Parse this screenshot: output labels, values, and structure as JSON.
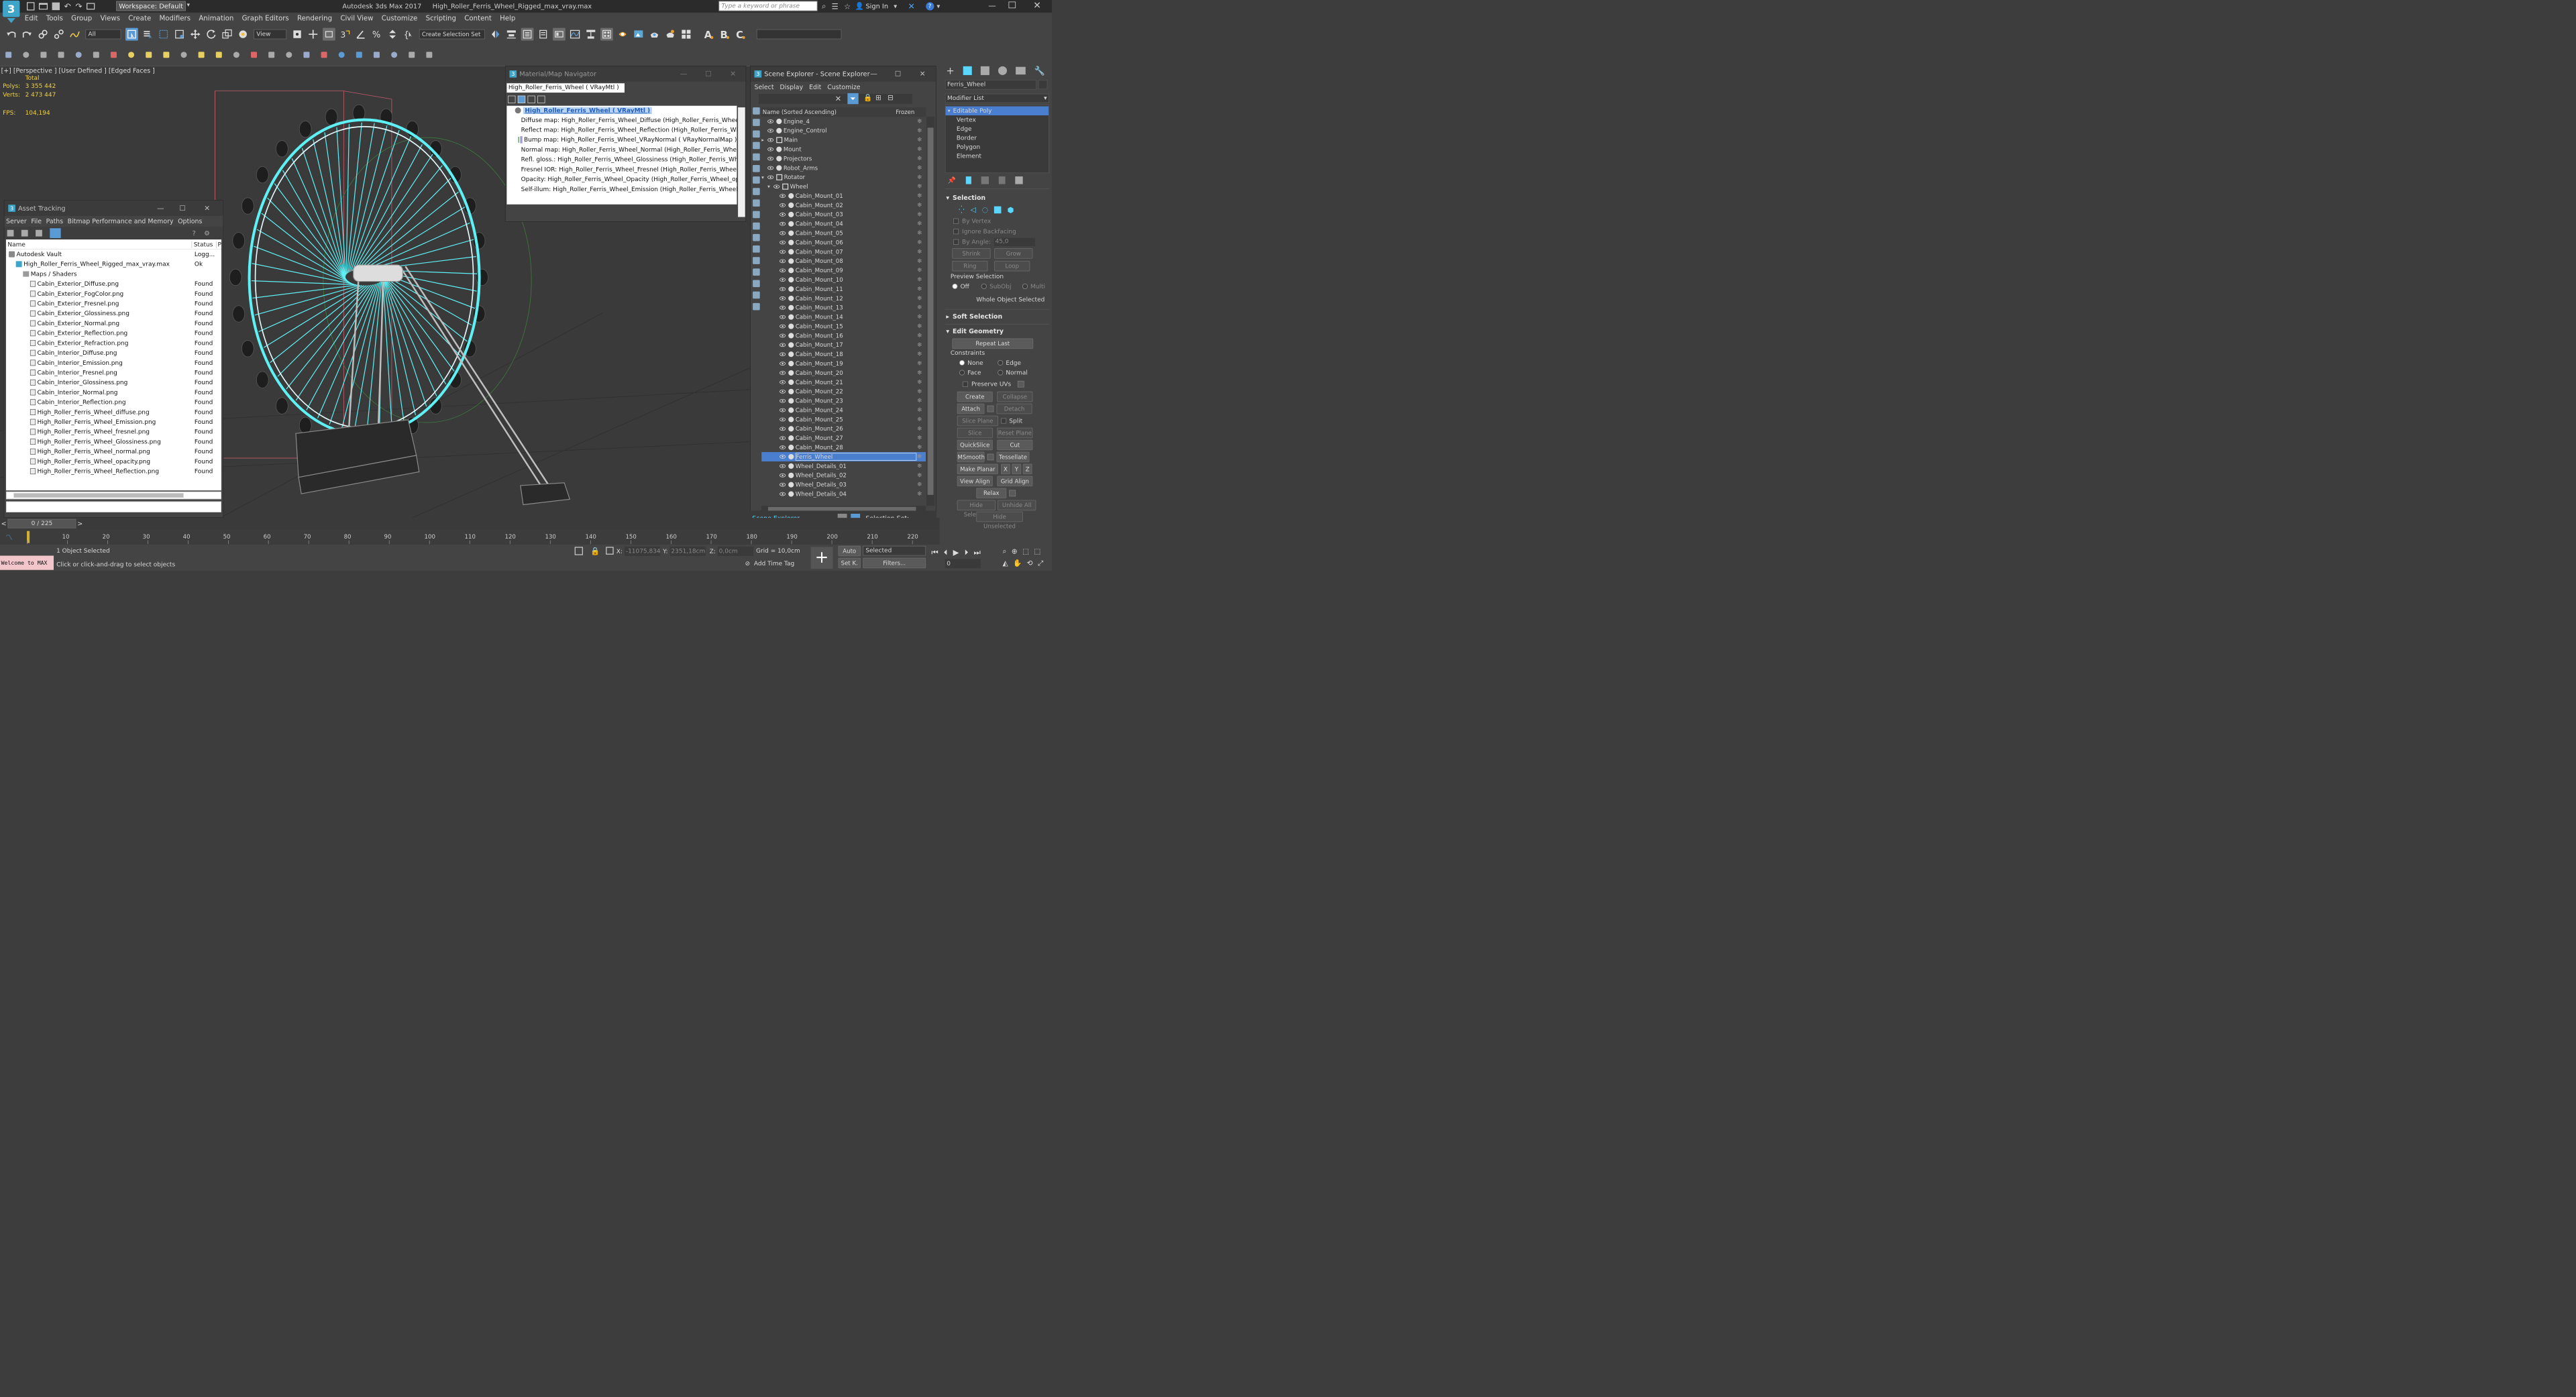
{
  "app": {
    "title": "Autodesk 3ds Max 2017",
    "file": "High_Roller_Ferris_Wheel_Rigged_max_vray.max",
    "workspace": "Workspace: Default",
    "search_placeholder": "Type a keyword or phrase",
    "sign_in": "Sign In"
  },
  "menu": [
    "Edit",
    "Tools",
    "Group",
    "Views",
    "Create",
    "Modifiers",
    "Animation",
    "Graph Editors",
    "Rendering",
    "Civil View",
    "Customize",
    "Scripting",
    "Content",
    "Help"
  ],
  "toolbar": {
    "filter": "All",
    "view": "View",
    "selection_set": "Create Selection Set"
  },
  "viewport": {
    "label": "[+] [Perspective ] [User Defined ] [Edged Faces ]",
    "total_label": "Total",
    "polys_label": "Polys:",
    "polys": "3 355 442",
    "verts_label": "Verts:",
    "verts": "2 473 447",
    "fps_label": "FPS:",
    "fps": "104,194"
  },
  "asset_tracking": {
    "title": "Asset Tracking",
    "menu": [
      "Server",
      "File",
      "Paths",
      "Bitmap Performance and Memory",
      "Options"
    ],
    "col_name": "Name",
    "col_status": "Status",
    "col_p": "P",
    "rows": [
      {
        "name": "Autodesk Vault",
        "status": "Logg...",
        "indent": 0,
        "kind": "vault"
      },
      {
        "name": "High_Roller_Ferris_Wheel_Rigged_max_vray.max",
        "status": "Ok",
        "indent": 1,
        "kind": "max"
      },
      {
        "name": "Maps / Shaders",
        "status": "",
        "indent": 2,
        "kind": "folder"
      },
      {
        "name": "Cabin_Exterior_Diffuse.png",
        "status": "Found",
        "indent": 3,
        "kind": "file"
      },
      {
        "name": "Cabin_Exterior_FogColor.png",
        "status": "Found",
        "indent": 3,
        "kind": "file"
      },
      {
        "name": "Cabin_Exterior_Fresnel.png",
        "status": "Found",
        "indent": 3,
        "kind": "file"
      },
      {
        "name": "Cabin_Exterior_Glossiness.png",
        "status": "Found",
        "indent": 3,
        "kind": "file"
      },
      {
        "name": "Cabin_Exterior_Normal.png",
        "status": "Found",
        "indent": 3,
        "kind": "file"
      },
      {
        "name": "Cabin_Exterior_Reflection.png",
        "status": "Found",
        "indent": 3,
        "kind": "file"
      },
      {
        "name": "Cabin_Exterior_Refraction.png",
        "status": "Found",
        "indent": 3,
        "kind": "file"
      },
      {
        "name": "Cabin_Interior_Diffuse.png",
        "status": "Found",
        "indent": 3,
        "kind": "file"
      },
      {
        "name": "Cabin_Interior_Emission.png",
        "status": "Found",
        "indent": 3,
        "kind": "file"
      },
      {
        "name": "Cabin_Interior_Fresnel.png",
        "status": "Found",
        "indent": 3,
        "kind": "file"
      },
      {
        "name": "Cabin_Interior_Glossiness.png",
        "status": "Found",
        "indent": 3,
        "kind": "file"
      },
      {
        "name": "Cabin_Interior_Normal.png",
        "status": "Found",
        "indent": 3,
        "kind": "file"
      },
      {
        "name": "Cabin_Interior_Reflection.png",
        "status": "Found",
        "indent": 3,
        "kind": "file"
      },
      {
        "name": "High_Roller_Ferris_Wheel_diffuse.png",
        "status": "Found",
        "indent": 3,
        "kind": "file"
      },
      {
        "name": "High_Roller_Ferris_Wheel_Emission.png",
        "status": "Found",
        "indent": 3,
        "kind": "file"
      },
      {
        "name": "High_Roller_Ferris_Wheel_fresnel.png",
        "status": "Found",
        "indent": 3,
        "kind": "file"
      },
      {
        "name": "High_Roller_Ferris_Wheel_Glossiness.png",
        "status": "Found",
        "indent": 3,
        "kind": "file"
      },
      {
        "name": "High_Roller_Ferris_Wheel_normal.png",
        "status": "Found",
        "indent": 3,
        "kind": "file"
      },
      {
        "name": "High_Roller_Ferris_Wheel_opacity.png",
        "status": "Found",
        "indent": 3,
        "kind": "file"
      },
      {
        "name": "High_Roller_Ferris_Wheel_Reflection.png",
        "status": "Found",
        "indent": 3,
        "kind": "file"
      }
    ]
  },
  "material_nav": {
    "title": "Material/Map Navigator",
    "field": "High_Roller_Ferris_Wheel  ( VRayMtl )",
    "root": "High_Roller_Ferris_Wheel  ( VRayMtl )",
    "items": [
      {
        "text": "Diffuse map: High_Roller_Ferris_Wheel_Diffuse (High_Roller_Ferris_Wheel_diffu",
        "sw": "#8a8a8a"
      },
      {
        "text": "Reflect map: High_Roller_Ferris_Wheel_Reflection (High_Roller_Ferris_Wheel_Re",
        "sw": "#777"
      },
      {
        "text": "Bump map: High_Roller_Ferris_Wheel_VRayNormal  ( VRayNormalMap )",
        "sw": "#9b9bd6"
      },
      {
        "text": "Normal map: High_Roller_Ferris_Wheel_Normal (High_Roller_Ferris_Wheel_no",
        "sw": "#a8a8e8"
      },
      {
        "text": "Refl. gloss.: High_Roller_Ferris_Wheel_Glossiness (High_Roller_Ferris_Wheel_Glc",
        "sw": "#bbb"
      },
      {
        "text": "Fresnel IOR: High_Roller_Ferris_Wheel_Fresnel (High_Roller_Ferris_Wheel_fresr",
        "sw": "#999"
      },
      {
        "text": "Opacity: High_Roller_Ferris_Wheel_Opacity (High_Roller_Ferris_Wheel_opacity.p",
        "sw": "#eee"
      },
      {
        "text": "Self-illum: High_Roller_Ferris_Wheel_Emission (High_Roller_Ferris_Wheel_Emiss",
        "sw": "#111"
      }
    ]
  },
  "scene_explorer": {
    "title": "Scene Explorer - Scene Explorer",
    "menu": [
      "Select",
      "Display",
      "Edit",
      "Customize"
    ],
    "col_name": "Name (Sorted Ascending)",
    "col_frozen": "Frozen",
    "footer_label": "Scene Explorer",
    "selection_set_label": "Selection Set:",
    "rows": [
      {
        "name": "Engine_4",
        "d": 0
      },
      {
        "name": "Engine_Control",
        "d": 0
      },
      {
        "name": "Main",
        "d": 0,
        "group": true
      },
      {
        "name": "Mount",
        "d": 0
      },
      {
        "name": "Projectors",
        "d": 0
      },
      {
        "name": "Robot_Arms",
        "d": 0
      },
      {
        "name": "Rotator",
        "d": 0,
        "group": true,
        "open": true
      },
      {
        "name": "Wheel",
        "d": 1,
        "group": true,
        "open": true
      },
      {
        "name": "Cabin_Mount_01",
        "d": 2
      },
      {
        "name": "Cabin_Mount_02",
        "d": 2
      },
      {
        "name": "Cabin_Mount_03",
        "d": 2
      },
      {
        "name": "Cabin_Mount_04",
        "d": 2
      },
      {
        "name": "Cabin_Mount_05",
        "d": 2
      },
      {
        "name": "Cabin_Mount_06",
        "d": 2
      },
      {
        "name": "Cabin_Mount_07",
        "d": 2
      },
      {
        "name": "Cabin_Mount_08",
        "d": 2
      },
      {
        "name": "Cabin_Mount_09",
        "d": 2
      },
      {
        "name": "Cabin_Mount_10",
        "d": 2
      },
      {
        "name": "Cabin_Mount_11",
        "d": 2
      },
      {
        "name": "Cabin_Mount_12",
        "d": 2
      },
      {
        "name": "Cabin_Mount_13",
        "d": 2
      },
      {
        "name": "Cabin_Mount_14",
        "d": 2
      },
      {
        "name": "Cabin_Mount_15",
        "d": 2
      },
      {
        "name": "Cabin_Mount_16",
        "d": 2
      },
      {
        "name": "Cabin_Mount_17",
        "d": 2
      },
      {
        "name": "Cabin_Mount_18",
        "d": 2
      },
      {
        "name": "Cabin_Mount_19",
        "d": 2
      },
      {
        "name": "Cabin_Mount_20",
        "d": 2
      },
      {
        "name": "Cabin_Mount_21",
        "d": 2
      },
      {
        "name": "Cabin_Mount_22",
        "d": 2
      },
      {
        "name": "Cabin_Mount_23",
        "d": 2
      },
      {
        "name": "Cabin_Mount_24",
        "d": 2
      },
      {
        "name": "Cabin_Mount_25",
        "d": 2
      },
      {
        "name": "Cabin_Mount_26",
        "d": 2
      },
      {
        "name": "Cabin_Mount_27",
        "d": 2
      },
      {
        "name": "Cabin_Mount_28",
        "d": 2
      },
      {
        "name": "Ferris_Wheel",
        "d": 2,
        "selected": true
      },
      {
        "name": "Wheel_Details_01",
        "d": 2
      },
      {
        "name": "Wheel_Details_02",
        "d": 2
      },
      {
        "name": "Wheel_Details_03",
        "d": 2
      },
      {
        "name": "Wheel_Details_04",
        "d": 2
      }
    ]
  },
  "command_panel": {
    "object_name": "Ferris_Wheel",
    "modifier_list": "Modifier List",
    "stack": [
      {
        "name": "Editable Poly",
        "selected": true
      },
      {
        "name": "Vertex"
      },
      {
        "name": "Edge"
      },
      {
        "name": "Border"
      },
      {
        "name": "Polygon"
      },
      {
        "name": "Element"
      }
    ],
    "selection": {
      "title": "Selection",
      "by_vertex": "By Vertex",
      "ignore_backfacing": "Ignore Backfacing",
      "by_angle": "By Angle:",
      "angle": "45,0",
      "shrink": "Shrink",
      "grow": "Grow",
      "ring": "Ring",
      "loop": "Loop",
      "preview": "Preview Selection",
      "off": "Off",
      "subobj": "SubObj",
      "multi": "Multi",
      "status": "Whole Object Selected"
    },
    "soft_selection": "Soft Selection",
    "edit_geometry": {
      "title": "Edit Geometry",
      "repeat_last": "Repeat Last",
      "constraints": "Constraints",
      "none": "None",
      "edge": "Edge",
      "face": "Face",
      "normal": "Normal",
      "preserve_uvs": "Preserve UVs",
      "create": "Create",
      "collapse": "Collapse",
      "attach": "Attach",
      "detach": "Detach",
      "slice_plane": "Slice Plane",
      "split": "Split",
      "slice": "Slice",
      "reset_plane": "Reset Plane",
      "quickslice": "QuickSlice",
      "cut": "Cut",
      "msmooth": "MSmooth",
      "tessellate": "Tessellate",
      "make_planar": "Make Planar",
      "x": "X",
      "y": "Y",
      "z": "Z",
      "view_align": "View Align",
      "grid_align": "Grid Align",
      "relax": "Relax",
      "hide_selected": "Hide Selected",
      "unhide_all": "Unhide All",
      "hide_unselected": "Hide Unselected"
    }
  },
  "timeline": {
    "counter": "0 / 225",
    "ticks": [
      "0",
      "10",
      "20",
      "30",
      "40",
      "50",
      "60",
      "70",
      "80",
      "90",
      "100",
      "110",
      "120",
      "130",
      "140",
      "150",
      "160",
      "170",
      "180",
      "190",
      "200",
      "210",
      "220"
    ]
  },
  "status": {
    "maxscript": "Welcome to MAX",
    "objects": "1 Object Selected",
    "prompt": "Click or click-and-drag to select objects",
    "x_label": "X:",
    "x": "-11075,834c",
    "y_label": "Y:",
    "y": "2351,18cm",
    "z_label": "Z:",
    "z": "0,0cm",
    "grid": "Grid = 10,0cm",
    "add_time_tag": "Add Time Tag",
    "auto": "Auto",
    "setk": "Set K.",
    "selected": "Selected",
    "filters": "Filters...",
    "frame": "0"
  }
}
